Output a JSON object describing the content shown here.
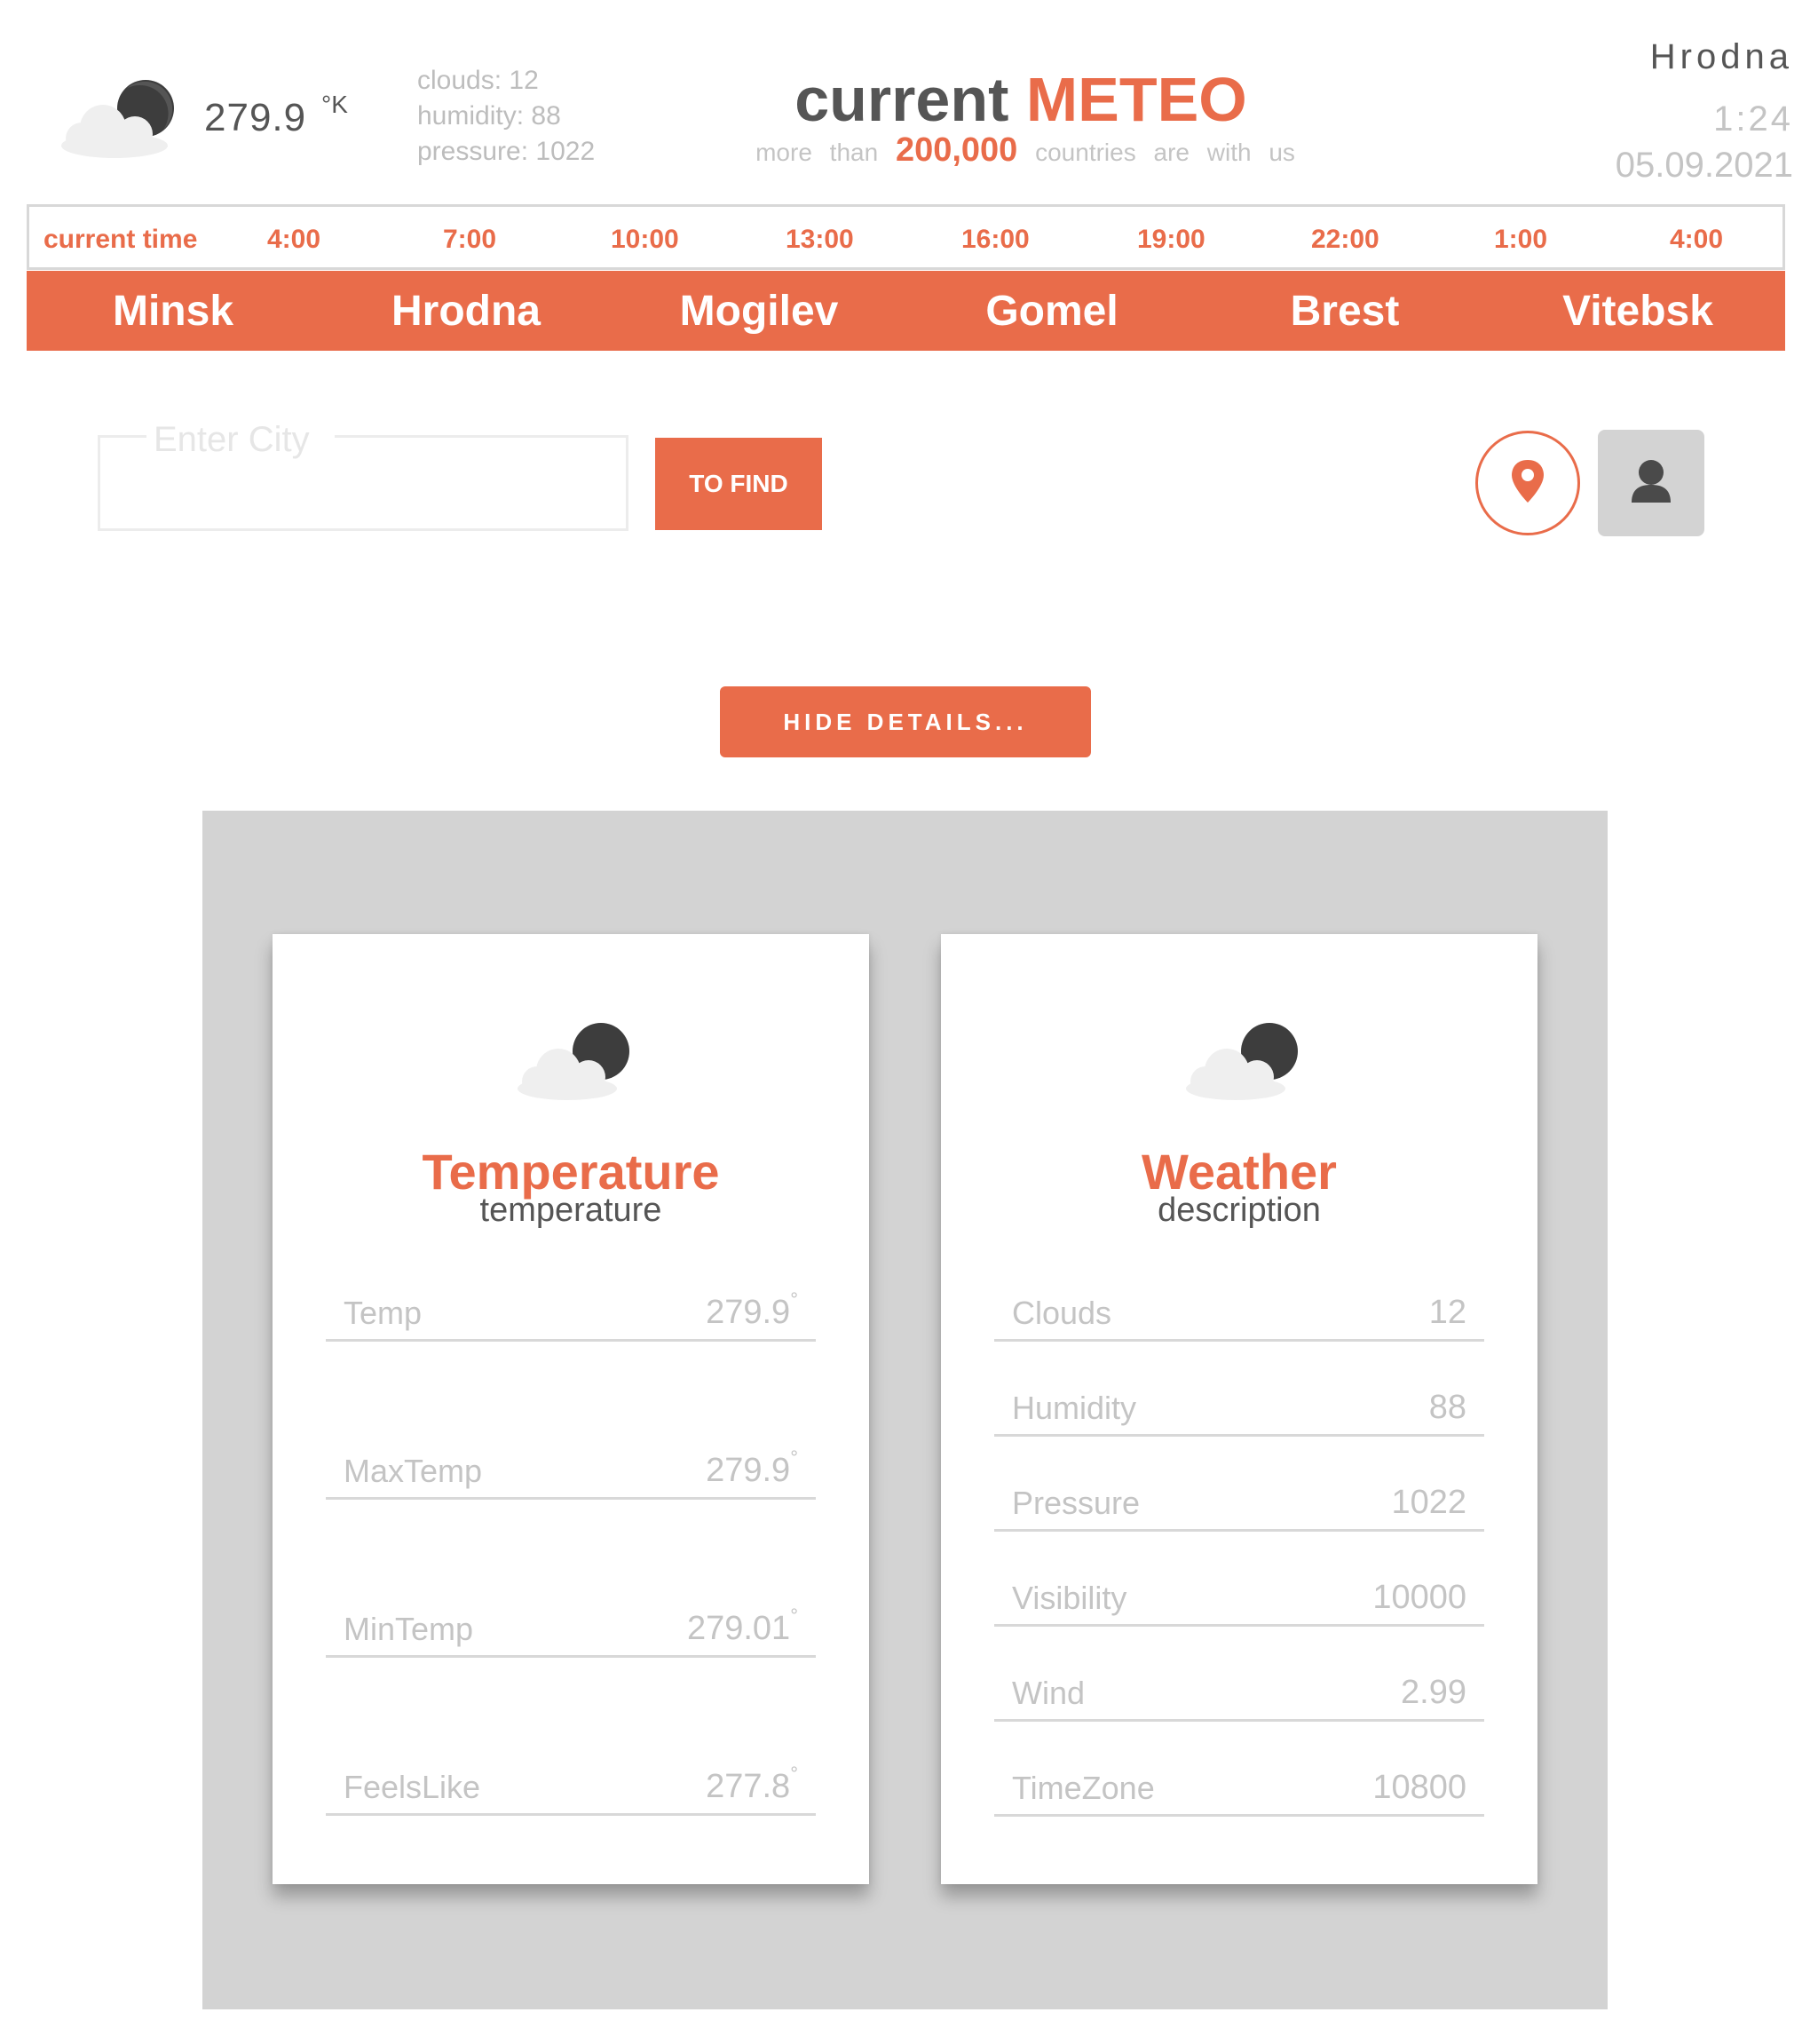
{
  "header": {
    "temperature": "279.9",
    "unit": "°K",
    "stats": [
      "clouds: 12",
      "humidity: 88",
      "pressure: 1022"
    ],
    "brand_part1": "current",
    "brand_part2": "METEO",
    "tagline_pre": "more than",
    "tagline_number": "200,000",
    "tagline_post": "countries are with us",
    "city": "Hrodna",
    "time": "1:24",
    "date": "05.09.2021",
    "weather_icon": "cloud-moon-icon"
  },
  "timebar": [
    "current time",
    "4:00",
    "7:00",
    "10:00",
    "13:00",
    "16:00",
    "19:00",
    "22:00",
    "1:00",
    "4:00"
  ],
  "cities": [
    "Minsk",
    "Hrodna",
    "Mogilev",
    "Gomel",
    "Brest",
    "Vitebsk"
  ],
  "search": {
    "placeholder": "Enter City",
    "button": "TO FIND",
    "location_icon": "map-pin-icon",
    "user_icon": "user-icon"
  },
  "details_button": "HIDE DETAILS...",
  "temperature_card": {
    "title": "Temperature",
    "subtitle": "temperature",
    "rows": [
      {
        "label": "Temp",
        "value": "279.9"
      },
      {
        "label": "MaxTemp",
        "value": "279.9"
      },
      {
        "label": "MinTemp",
        "value": "279.01"
      },
      {
        "label": "FeelsLike",
        "value": "277.8"
      }
    ],
    "degree_mark": "°"
  },
  "weather_card": {
    "title": "Weather",
    "subtitle": "description",
    "rows": [
      {
        "label": "Clouds",
        "value": "12"
      },
      {
        "label": "Humidity",
        "value": "88"
      },
      {
        "label": "Pressure",
        "value": "1022"
      },
      {
        "label": "Visibility",
        "value": "10000"
      },
      {
        "label": "Wind",
        "value": "2.99"
      },
      {
        "label": "TimeZone",
        "value": "10800"
      }
    ]
  },
  "colors": {
    "accent": "#e96c4a",
    "panel": "#d3d3d3",
    "muted": "#c4c4c4"
  }
}
